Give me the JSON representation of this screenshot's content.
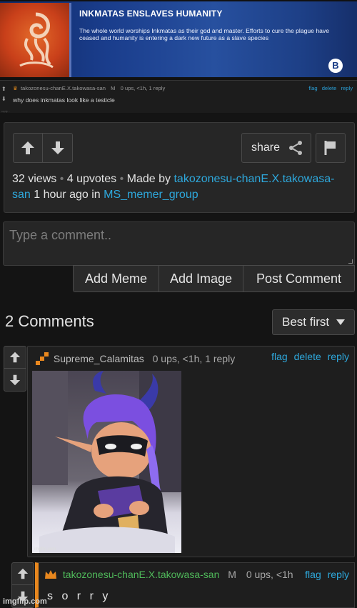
{
  "meme": {
    "title": "INKMATAS ENSLAVES HUMANITY",
    "text": "The whole world worships Inkmatas as their god and master. Efforts to cure the plague have ceased and humanity is entering a dark new future as a slave species",
    "badge": "B",
    "logo_icon": "octopus-icon"
  },
  "mini_comment": {
    "user": "takozonesu-chanE.X.takowasa-san",
    "mod_badge": "M",
    "meta": "0 ups, <1h, 1 reply",
    "actions": [
      "flag",
      "delete",
      "reply"
    ],
    "text": "why does inkmatas look like a testicle",
    "reply_hint": "reply..."
  },
  "post": {
    "share_label": "share",
    "views": "32 views",
    "upvotes": "4 upvotes",
    "made_by_prefix": "Made by",
    "author": "takozonesu-chanE.X.takowasa-san",
    "time": "1 hour ago in",
    "group": "MS_memer_group"
  },
  "composer": {
    "placeholder": "Type a comment..",
    "buttons": [
      "Add Meme",
      "Add Image",
      "Post Comment"
    ]
  },
  "comments_header": {
    "count": "2 Comments",
    "sort_label": "Best first"
  },
  "comments": [
    {
      "user": "Supreme_Calamitas",
      "meta": "0 ups, <1h, 1 reply",
      "actions": [
        "flag",
        "delete",
        "reply"
      ],
      "image_watermark": "imgflip.com",
      "icon_color": "#e8871e"
    },
    {
      "user": "takozonesu-chanE.X.takowasa-san",
      "mod_badge": "M",
      "meta": "0 ups, <1h",
      "actions": [
        "flag",
        "reply"
      ],
      "text": "s o r r y",
      "user_color": "#4fb85a",
      "accent": "#e8871e"
    }
  ],
  "footer_watermark": "imgflip.com"
}
